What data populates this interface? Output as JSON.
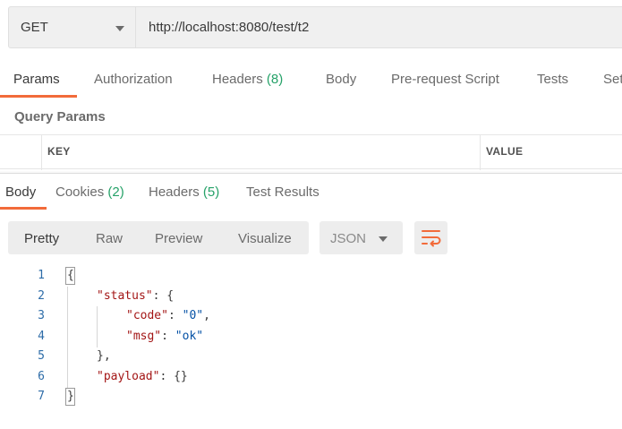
{
  "request": {
    "method": "GET",
    "url": "http://localhost:8080/test/t2"
  },
  "request_tabs": [
    {
      "label": "Params",
      "active": true
    },
    {
      "label": "Authorization"
    },
    {
      "label": "Headers",
      "count": "(8)"
    },
    {
      "label": "Body"
    },
    {
      "label": "Pre-request Script"
    },
    {
      "label": "Tests"
    },
    {
      "label": "Set"
    }
  ],
  "params": {
    "title": "Query Params",
    "columns": [
      "KEY",
      "VALUE"
    ]
  },
  "response_tabs": [
    {
      "label": "Body",
      "active": true
    },
    {
      "label": "Cookies",
      "count": "(2)"
    },
    {
      "label": "Headers",
      "count": "(5)"
    },
    {
      "label": "Test Results"
    }
  ],
  "view_modes": [
    "Pretty",
    "Raw",
    "Preview",
    "Visualize"
  ],
  "format": "JSON",
  "code": {
    "line_numbers": [
      "1",
      "2",
      "3",
      "4",
      "5",
      "6",
      "7"
    ],
    "tokens": {
      "open_brace": "{",
      "status_key": "\"status\"",
      "colon_open": ": {",
      "code_key": "\"code\"",
      "colon": ":",
      "code_val": "\"0\"",
      "comma": ",",
      "msg_key": "\"msg\"",
      "msg_val": "\"ok\"",
      "close_inner": "},",
      "payload_key": "\"payload\"",
      "payload_val": "{}",
      "close_brace": "}"
    }
  },
  "colors": {
    "accent": "#f26b3a",
    "count_green": "#26a269",
    "json_key": "#a31515",
    "json_string": "#0451a5"
  },
  "icons": [
    "chevron-down-icon",
    "wrap-lines-icon"
  ]
}
